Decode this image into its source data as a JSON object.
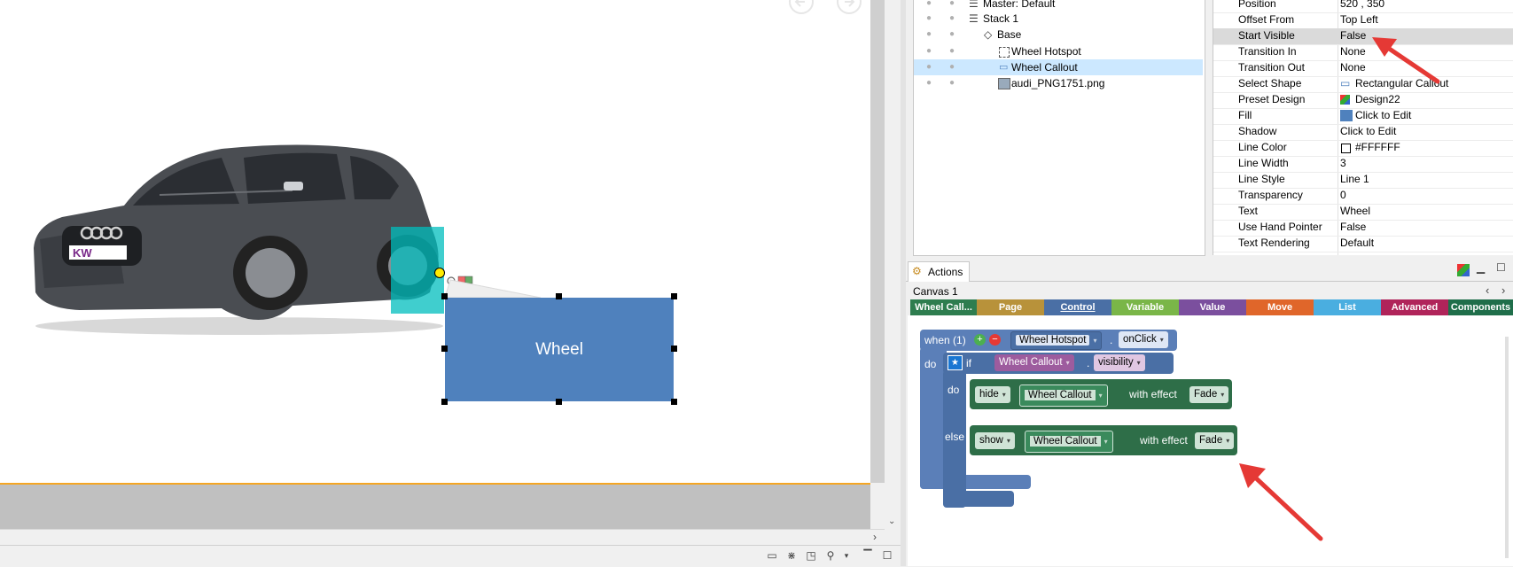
{
  "canvas": {
    "callout_text": "Wheel",
    "nav_back_icon": "circle-left-arrow-icon",
    "nav_forward_icon": "circle-right-arrow-icon"
  },
  "tree": {
    "items": [
      {
        "label": "Master: Default",
        "icon": "layers-icon"
      },
      {
        "label": "Stack 1",
        "icon": "layers-icon"
      },
      {
        "label": "Base",
        "icon": "diamond-icon"
      },
      {
        "label": "Wheel Hotspot",
        "icon": "hotspot-icon"
      },
      {
        "label": "Wheel Callout",
        "icon": "callout-icon",
        "selected": true
      },
      {
        "label": "audi_PNG1751.png",
        "icon": "image-icon"
      }
    ]
  },
  "properties": {
    "rows": [
      {
        "key": "Position",
        "value": "520 , 350"
      },
      {
        "key": "Offset From",
        "value": "Top Left"
      },
      {
        "key": "Start Visible",
        "value": "False",
        "selected": true
      },
      {
        "key": "Transition In",
        "value": "None"
      },
      {
        "key": "Transition Out",
        "value": "None"
      },
      {
        "key": "Select Shape",
        "value": "Rectangular Callout",
        "icon": "callout-icon"
      },
      {
        "key": "Preset Design",
        "value": "Design22",
        "icon": "palette-icon"
      },
      {
        "key": "Fill",
        "value": "Click to Edit",
        "swatch": "#4f81bd"
      },
      {
        "key": "Shadow",
        "value": "Click to Edit"
      },
      {
        "key": "Line Color",
        "value": "#FFFFFF",
        "swatch": "#ffffff"
      },
      {
        "key": "Line Width",
        "value": "3"
      },
      {
        "key": "Line Style",
        "value": "Line 1"
      },
      {
        "key": "Transparency",
        "value": "0"
      },
      {
        "key": "Text",
        "value": "Wheel"
      },
      {
        "key": "Use Hand Pointer",
        "value": "False"
      },
      {
        "key": "Text Rendering",
        "value": "Default"
      }
    ]
  },
  "actions": {
    "tab_label": "Actions",
    "canvas_tab": "Canvas 1",
    "categories": [
      {
        "label": "Wheel Call...",
        "color": "#2e7d4f"
      },
      {
        "label": "Page",
        "color": "#b8923a"
      },
      {
        "label": "Control",
        "color": "#4a6fa5"
      },
      {
        "label": "Variable",
        "color": "#7ab648"
      },
      {
        "label": "Value",
        "color": "#7b4f9e"
      },
      {
        "label": "Move",
        "color": "#e0662a"
      },
      {
        "label": "List",
        "color": "#4aaee0"
      },
      {
        "label": "Advanced",
        "color": "#b0245a"
      },
      {
        "label": "Components",
        "color": "#1f6e4a"
      }
    ],
    "block": {
      "when": "when (1)",
      "trigger_target": "Wheel Hotspot",
      "trigger_event": "onClick",
      "do": "do",
      "if": "if",
      "cond_target": "Wheel Callout",
      "cond_prop": "visibility",
      "inner_do": "do",
      "else": "else",
      "action1_verb": "hide",
      "action1_target": "Wheel Callout",
      "action1_with": "with effect",
      "action1_effect": "Fade",
      "action2_verb": "show",
      "action2_target": "Wheel Callout",
      "action2_with": "with effect",
      "action2_effect": "Fade"
    }
  },
  "colors": {
    "callout_fill": "#4f81bd",
    "hotspot_fill": "#00bebe",
    "annotation_arrow": "#e53935"
  }
}
